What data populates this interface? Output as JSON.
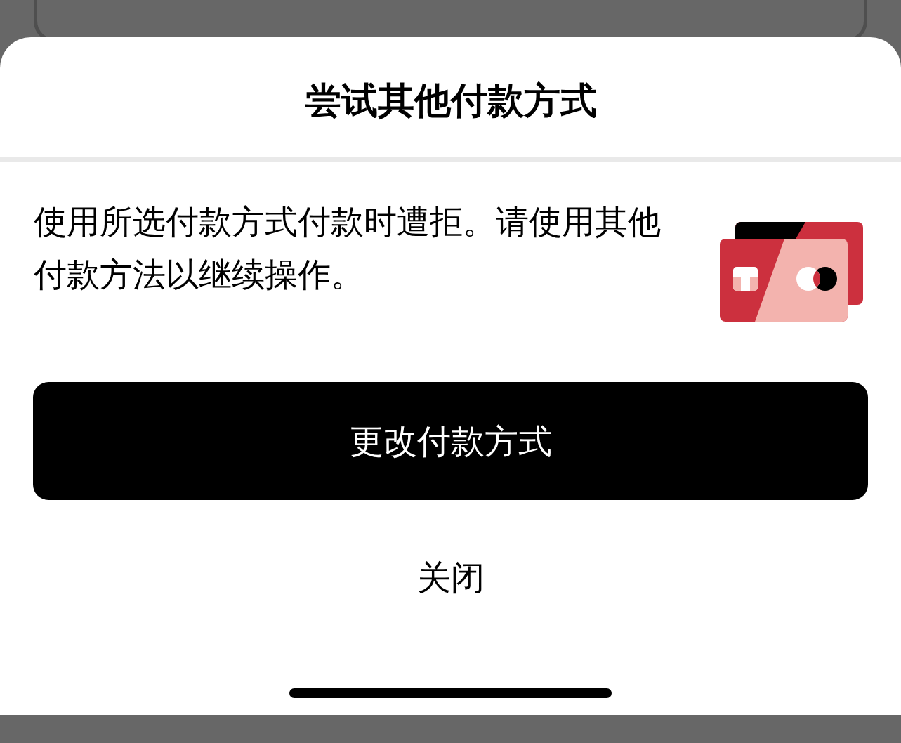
{
  "sheet": {
    "title": "尝试其他付款方式",
    "message": "使用所选付款方式付款时遭拒。请使用其他付款方法以继续操作。",
    "primary_button": "更改付款方式",
    "secondary_button": "关闭"
  }
}
